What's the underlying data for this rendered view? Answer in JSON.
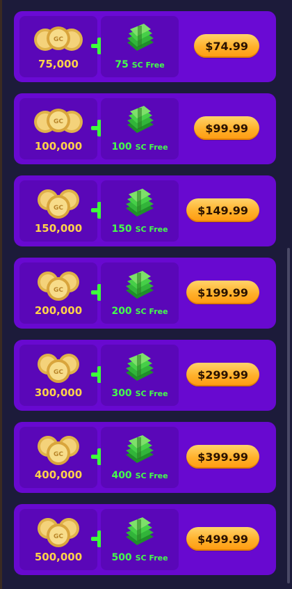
{
  "packages": [
    {
      "gc": "75,000",
      "sc": "75",
      "sc_unit": "SC Free",
      "price": "$74.99"
    },
    {
      "gc": "100,000",
      "sc": "100",
      "sc_unit": "SC Free",
      "price": "$99.99"
    },
    {
      "gc": "150,000",
      "sc": "150",
      "sc_unit": "SC Free",
      "price": "$149.99"
    },
    {
      "gc": "200,000",
      "sc": "200",
      "sc_unit": "SC Free",
      "price": "$199.99"
    },
    {
      "gc": "300,000",
      "sc": "300",
      "sc_unit": "SC Free",
      "price": "$299.99"
    },
    {
      "gc": "400,000",
      "sc": "400",
      "sc_unit": "SC Free",
      "price": "$399.99"
    },
    {
      "gc": "500,000",
      "sc": "500",
      "sc_unit": "SC Free",
      "price": "$499.99"
    }
  ],
  "icons": {
    "coins": "gold-coins-icon",
    "bills": "cash-stack-icon",
    "plus": "plus-icon"
  },
  "colors": {
    "card": "#6a0ad4",
    "tile": "#5a07b8",
    "gc_text": "#ffd24a",
    "sc_text": "#45ff4a",
    "button": "#ffb02a"
  }
}
